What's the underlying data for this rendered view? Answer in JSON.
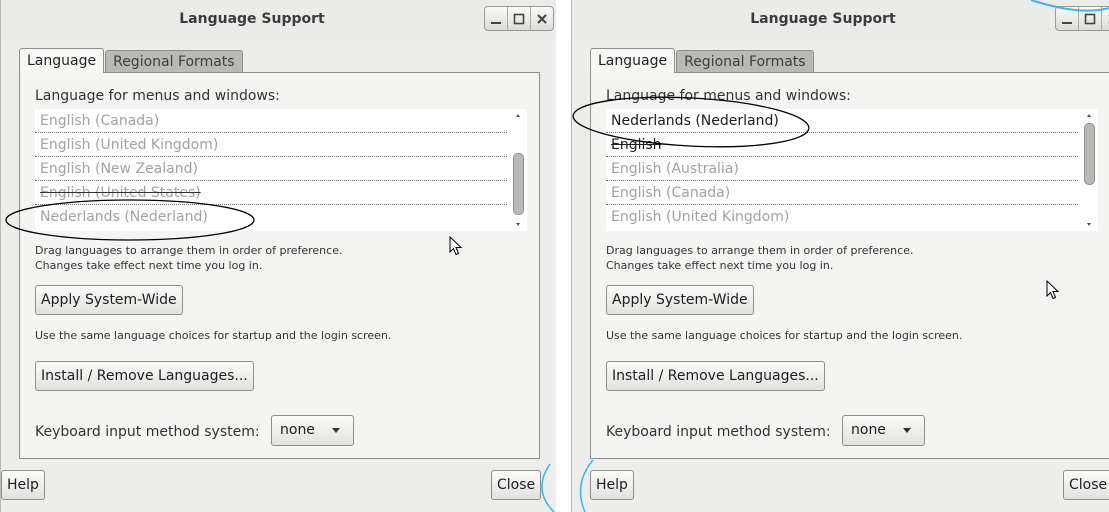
{
  "dialogs": [
    {
      "title": "Language Support",
      "tabs": [
        "Language",
        "Regional Formats"
      ],
      "list_label": "Language for menus and windows:",
      "languages": [
        "English (Canada)",
        "English (United Kingdom)",
        "English (New Zealand)",
        "English (United States)",
        "Nederlands (Nederland)"
      ],
      "hint_line1": "Drag languages to arrange them in order of preference.",
      "hint_line2": "Changes take effect next time you log in.",
      "apply_button": "Apply System-Wide",
      "apply_desc": "Use the same language choices for startup and the login screen.",
      "install_button": "Install / Remove Languages...",
      "keyboard_label": "Keyboard input method system:",
      "keyboard_value": "none",
      "help_button": "Help",
      "close_button": "Close"
    },
    {
      "title": "Language Support",
      "tabs": [
        "Language",
        "Regional Formats"
      ],
      "list_label": "Language for menus and windows:",
      "languages": [
        "Nederlands (Nederland)",
        "English",
        "English (Australia)",
        "English (Canada)",
        "English (United Kingdom)"
      ],
      "hint_line1": "Drag languages to arrange them in order of preference.",
      "hint_line2": "Changes take effect next time you log in.",
      "apply_button": "Apply System-Wide",
      "apply_desc": "Use the same language choices for startup and the login screen.",
      "install_button": "Install / Remove Languages...",
      "keyboard_label": "Keyboard input method system:",
      "keyboard_value": "none",
      "help_button": "Help",
      "close_button": "Close"
    }
  ],
  "icons": {
    "minimize": "minimize-icon",
    "maximize": "maximize-icon",
    "close": "close-icon",
    "cursor": "mouse-pointer-icon"
  },
  "colors": {
    "dialog_bg": "#ededec",
    "tab_inactive": "#b9b9b7",
    "annotation": "#000000",
    "decoration": "#37b7f4"
  }
}
